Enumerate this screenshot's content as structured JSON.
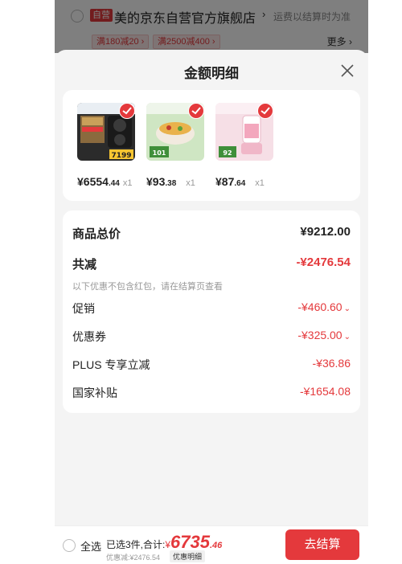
{
  "store": {
    "tag": "自营",
    "name": "美的京东自营官方旗舰店",
    "chevron": "›",
    "shipping_note": "运费以结算时为准",
    "promos": [
      "满180减20 ›",
      "满2500减400 ›"
    ],
    "more": "更多 ›"
  },
  "sheet": {
    "title": "金额明细"
  },
  "products": [
    {
      "price_int": "¥6554",
      "price_dec": ".44",
      "qty": "x1",
      "image_label": "7199"
    },
    {
      "price_int": "¥93",
      "price_dec": ".38",
      "qty": "x1",
      "image_label": "101"
    },
    {
      "price_int": "¥87",
      "price_dec": ".64",
      "qty": "x1",
      "image_label": "92"
    }
  ],
  "breakdown": {
    "total_label": "商品总价",
    "total_value": "¥9212.00",
    "discount_label": "共减",
    "discount_value": "-¥2476.54",
    "note": "以下优惠不包含红包，请在结算页查看",
    "items": [
      {
        "label": "促销",
        "value": "-¥460.60",
        "chevron": "⌄"
      },
      {
        "label": "优惠券",
        "value": "-¥325.00",
        "chevron": "⌄"
      },
      {
        "label": "PLUS 专享立减",
        "value": "-¥36.86",
        "chevron": ""
      },
      {
        "label": "国家补贴",
        "value": "-¥1654.08",
        "chevron": ""
      }
    ]
  },
  "bottom": {
    "select_all": "全选",
    "summary_prefix": "已选3件,合计:",
    "currency": "¥",
    "total_int": "6735",
    "total_dec": ".46",
    "saved": "优惠减:¥2476.54",
    "detail_link": "优惠明细",
    "checkout": "去结算"
  },
  "colors": {
    "accent": "#e4393c",
    "sheet_bg": "#f4f4f4"
  }
}
